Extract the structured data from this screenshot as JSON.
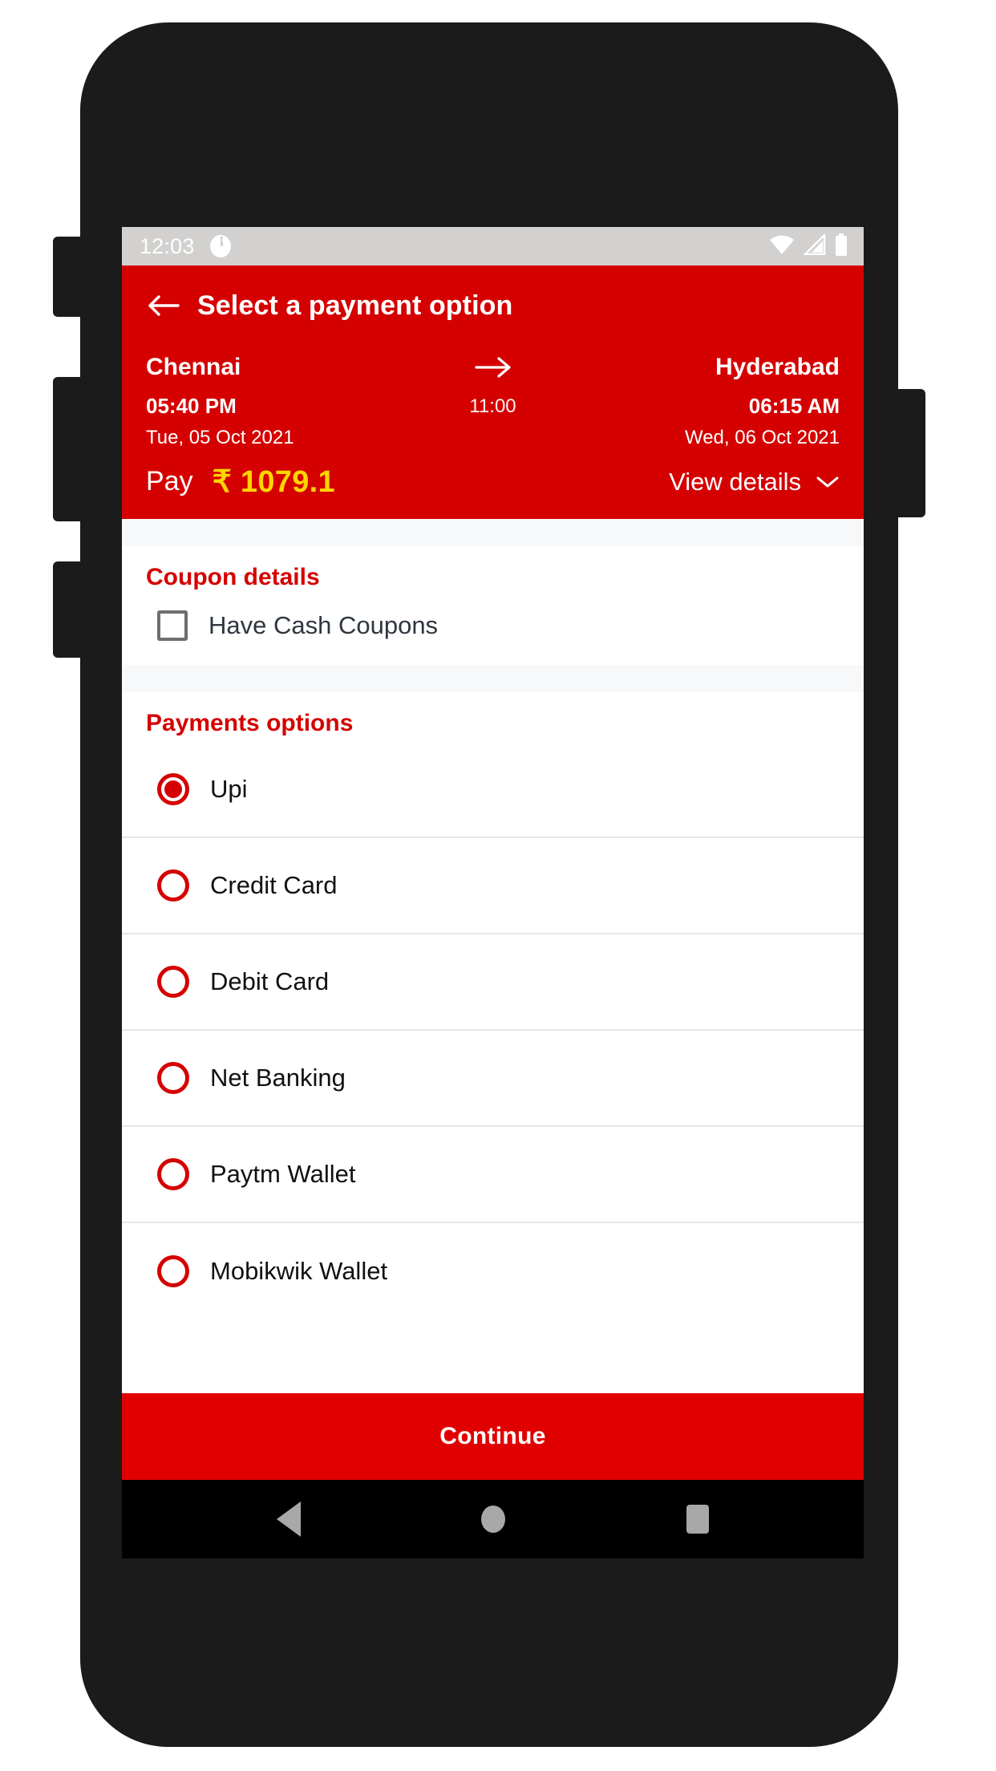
{
  "statusbar": {
    "time": "12:03",
    "app_icon": "clock-app-icon",
    "wifi_icon": "wifi-icon",
    "signal_icon": "cellular-signal-icon",
    "battery_icon": "battery-icon"
  },
  "appbar": {
    "back_icon": "back-arrow-icon",
    "title": "Select a payment option"
  },
  "journey": {
    "origin": "Chennai",
    "destination": "Hyderabad",
    "arrow_icon": "arrow-right-icon",
    "departure_time": "05:40 PM",
    "arrival_time": "06:15 AM",
    "duration": "11:00",
    "departure_date": "Tue, 05 Oct 2021",
    "arrival_date": "Wed, 06 Oct 2021"
  },
  "pay": {
    "label": "Pay",
    "amount": "₹ 1079.1",
    "view_details_label": "View details",
    "chevron_icon": "chevron-down-icon",
    "amount_color": "#ffd600"
  },
  "coupon": {
    "title": "Coupon details",
    "checkbox_label": "Have Cash Coupons",
    "checked": false
  },
  "payments": {
    "title": "Payments options",
    "selected": "Upi",
    "options": [
      {
        "label": "Upi",
        "selected": true
      },
      {
        "label": "Credit Card",
        "selected": false
      },
      {
        "label": "Debit Card",
        "selected": false
      },
      {
        "label": "Net Banking",
        "selected": false
      },
      {
        "label": "Paytm Wallet",
        "selected": false
      },
      {
        "label": "Mobikwik Wallet",
        "selected": false
      }
    ]
  },
  "footer": {
    "continue_label": "Continue"
  },
  "navbar": {
    "back_icon": "nav-back-icon",
    "home_icon": "nav-home-icon",
    "recents_icon": "nav-recents-icon"
  },
  "theme": {
    "brand_red": "#d50000",
    "accent_yellow": "#ffd600",
    "button_red": "#e00000"
  }
}
